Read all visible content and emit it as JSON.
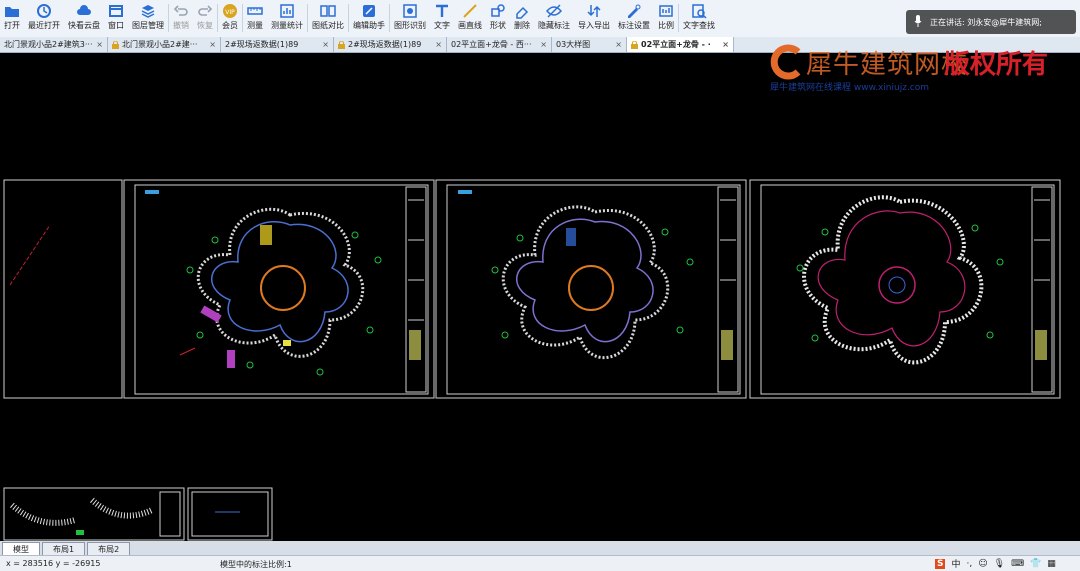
{
  "toolbar": {
    "buttons": [
      {
        "label": "打开",
        "icon": "folder-icon",
        "color": "#2b6fd6"
      },
      {
        "label": "最近打开",
        "icon": "clock-icon",
        "color": "#2b6fd6"
      },
      {
        "label": "快看云盘",
        "icon": "cloud-icon",
        "color": "#2b6fd6"
      },
      {
        "label": "窗口",
        "icon": "window-icon",
        "color": "#2b6fd6"
      },
      {
        "label": "图层管理",
        "icon": "layers-icon",
        "color": "#2b6fd6"
      },
      {
        "label": "撤销",
        "icon": "undo-icon",
        "color": "#9aa4b0",
        "disabled": true
      },
      {
        "label": "恢复",
        "icon": "redo-icon",
        "color": "#9aa4b0",
        "disabled": true
      },
      {
        "label": "会员",
        "icon": "vip-icon",
        "color": "#d9a520"
      },
      {
        "label": "测量",
        "icon": "ruler-icon",
        "color": "#2b6fd6"
      },
      {
        "label": "测量统计",
        "icon": "measure-stats-icon",
        "color": "#2b6fd6"
      },
      {
        "label": "图纸对比",
        "icon": "compare-icon",
        "color": "#2b6fd6"
      },
      {
        "label": "编辑助手",
        "icon": "edit-assistant-icon",
        "color": "#2b6fd6"
      },
      {
        "label": "图形识别",
        "icon": "shape-recognize-icon",
        "color": "#2b6fd6"
      },
      {
        "label": "文字",
        "icon": "text-icon",
        "color": "#2b6fd6"
      },
      {
        "label": "画直线",
        "icon": "line-icon",
        "color": "#d9a520"
      },
      {
        "label": "形状",
        "icon": "shape-icon",
        "color": "#2b6fd6"
      },
      {
        "label": "删除",
        "icon": "eraser-icon",
        "color": "#2b6fd6"
      },
      {
        "label": "隐藏标注",
        "icon": "eye-hide-icon",
        "color": "#2b6fd6"
      },
      {
        "label": "导入导出",
        "icon": "import-export-icon",
        "color": "#2b6fd6"
      },
      {
        "label": "标注设置",
        "icon": "annotation-settings-icon",
        "color": "#2b6fd6"
      },
      {
        "label": "比例",
        "icon": "scale-icon",
        "color": "#2b6fd6"
      },
      {
        "label": "文字查找",
        "icon": "text-search-icon",
        "color": "#2b6fd6"
      }
    ]
  },
  "voice": {
    "text": "正在讲话: 刘永安@犀牛建筑网;"
  },
  "tabs": [
    {
      "label": "北门景观小品2#建筑3···",
      "lock": false,
      "active": false
    },
    {
      "label": "北门景观小品2#建···",
      "lock": true,
      "active": false
    },
    {
      "label": "2#现场返数据(1)89",
      "lock": false,
      "active": false
    },
    {
      "label": "2#现场返数据(1)89",
      "lock": true,
      "active": false
    },
    {
      "label": "02平立面+龙骨 - 西···",
      "lock": false,
      "active": false
    },
    {
      "label": "03大样图",
      "lock": false,
      "active": false
    },
    {
      "label": "02平立面+龙骨 - ·",
      "lock": true,
      "active": true
    }
  ],
  "watermark": {
    "title": "犀牛建筑网校",
    "copyright": "版权所有",
    "subtitle": "犀牛建筑网在线课程 www.xiniujz.com"
  },
  "layout_tabs": [
    "模型",
    "布局1",
    "布局2"
  ],
  "status": {
    "coords": "x = 283516  y = -26915",
    "scale": "模型中的标注比例:1"
  },
  "tray": {
    "ime": "中",
    "items": [
      "·,",
      "☺",
      "🎙",
      "⌨",
      "👕",
      "▦"
    ]
  },
  "colors": {
    "canvas": "#000000",
    "accent": "#2b6fd6",
    "watermark_red": "#d8202a"
  }
}
